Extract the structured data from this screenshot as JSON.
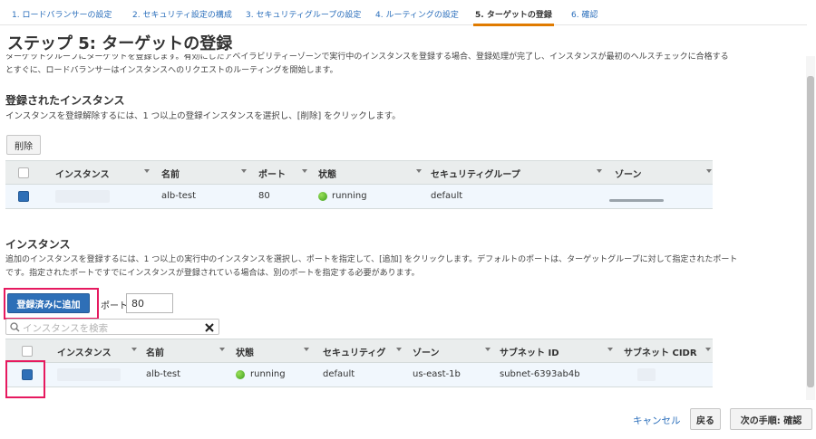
{
  "wizard": {
    "steps": [
      "1. ロードバランサーの設定",
      "2. セキュリティ設定の構成",
      "3. セキュリティグループの設定",
      "4. ルーティングの設定",
      "5. ターゲットの登録",
      "6. 確認"
    ]
  },
  "page": {
    "title": "ステップ 5: ターゲットの登録",
    "intro_line1": "ターゲットグループにターゲットを登録します。有効にしたアベイラビリティーゾーンで実行中のインスタンスを登録する場合、登録処理が完了し、インスタンスが最初のヘルスチェックに合格する",
    "intro_line2": "とすぐに、ロードバランサーはインスタンスへのリクエストのルーティングを開始します。"
  },
  "registered": {
    "heading": "登録されたインスタンス",
    "description": "インスタンスを登録解除するには、1 つ以上の登録インスタンスを選択し、[削除] をクリックします。",
    "delete_label": "削除",
    "columns": [
      "インスタンス",
      "名前",
      "ポート",
      "状態",
      "セキュリティグループ",
      "ゾーン"
    ],
    "rows": [
      {
        "name": "alb-test",
        "port": "80",
        "status": "running",
        "security_group": "default"
      }
    ]
  },
  "instances": {
    "heading": "インスタンス",
    "description_line1": "追加のインスタンスを登録するには、1 つ以上の実行中のインスタンスを選択し、ポートを指定して、[追加] をクリックします。デフォルトのポートは、ターゲットグループに対して指定されたポート",
    "description_line2": "です。指定されたポートですでにインスタンスが登録されている場合は、別のポートを指定する必要があります。",
    "add_label": "登録済みに追加",
    "port_label": "ポート",
    "port_value": "80",
    "search_placeholder": "インスタンスを検索",
    "columns": [
      "インスタンス",
      "名前",
      "状態",
      "セキュリティグ",
      "ゾーン",
      "サブネット ID",
      "サブネット CIDR"
    ],
    "rows": [
      {
        "name": "alb-test",
        "status": "running",
        "security_group": "default",
        "zone": "us-east-1b",
        "subnet_id": "subnet-6393ab4b"
      }
    ]
  },
  "footer": {
    "cancel_label": "キャンセル",
    "back_label": "戻る",
    "next_label": "次の手順: 確認"
  },
  "colors": {
    "primary": "#2e6fb7",
    "highlight": "#e6195f",
    "active_step": "#e07b00",
    "running": "#3a9d1a"
  },
  "icons": {
    "status": "green-dot-icon",
    "clear": "close-icon",
    "search": "search-icon",
    "sort": "caret-down-icon"
  }
}
